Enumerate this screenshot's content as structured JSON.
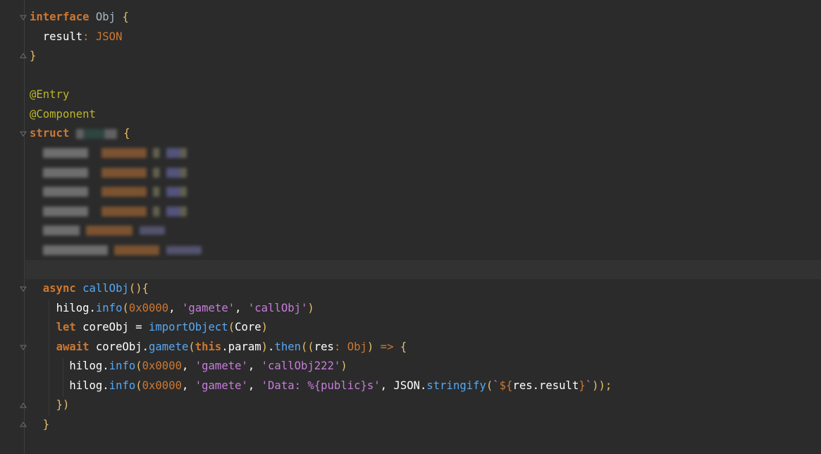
{
  "code": {
    "l1": {
      "kw": "interface",
      "name": "Obj",
      "brace": "{"
    },
    "l2": {
      "field": "result",
      "colon": ":",
      "type": "JSON"
    },
    "l3": {
      "brace": "}"
    },
    "l5": {
      "ann": "@Entry"
    },
    "l6": {
      "ann": "@Component"
    },
    "l7": {
      "kw": "struct",
      "brace": "{"
    },
    "l9": {
      "kw": "async",
      "fn": "callObj",
      "rest": "(){"
    },
    "l10": {
      "obj": "hilog",
      "dot": ".",
      "fn": "info",
      "open": "(",
      "num": "0x0000",
      "sep1": ", ",
      "s1": "'gamete'",
      "sep2": ", ",
      "s2": "'callObj'",
      "close": ")"
    },
    "l11": {
      "kw": "let",
      "var": "coreObj",
      "eq": " = ",
      "fn": "importObject",
      "open": "(",
      "arg": "Core",
      "close": ")"
    },
    "l12": {
      "kw": "await",
      "obj": "coreObj",
      "dot1": ".",
      "fn1": "gamete",
      "open1": "(",
      "this": "this",
      "prop": ".param",
      "close1": ")",
      "dot2": ".",
      "fn2": "then",
      "open2": "((",
      "arg": "res",
      "colon": ": ",
      "type": "Obj",
      "close2": ")",
      "arrow": " => ",
      "brace": "{"
    },
    "l13": {
      "obj": "hilog",
      "dot": ".",
      "fn": "info",
      "open": "(",
      "num": "0x0000",
      "sep1": ", ",
      "s1": "'gamete'",
      "sep2": ", ",
      "s2": "'callObj222'",
      "close": ")"
    },
    "l14": {
      "obj": "hilog",
      "dot": ".",
      "fn": "info",
      "open": "(",
      "num": "0x0000",
      "sep1": ", ",
      "s1": "'gamete'",
      "sep2": ", ",
      "s2a": "'Data: ",
      "s2b": "%{public}s",
      "s2c": "'",
      "sep3": ", ",
      "json": "JSON",
      "dot2": ".",
      "fn2": "stringify",
      "open2": "(",
      "tpl1": "`",
      "tpl2": "${",
      "expr": "res.result",
      "tpl3": "}",
      "tpl4": "`",
      "close2": "));"
    },
    "l15": {
      "close": "})"
    },
    "l16": {
      "close": "}"
    }
  }
}
